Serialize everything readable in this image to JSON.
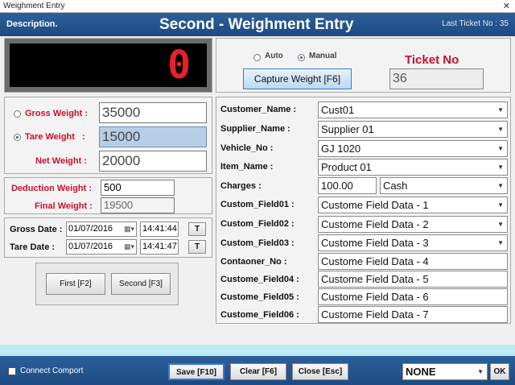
{
  "window": {
    "title": "Weighment Entry",
    "close_glyph": "✕"
  },
  "header": {
    "description": "Description.",
    "title": "Second - Weighment Entry",
    "last_ticket": "Last Ticket No :  35"
  },
  "display": {
    "digit": "0",
    "digit_color": "#e8202a"
  },
  "mode": {
    "auto_label": "Auto",
    "manual_label": "Manual",
    "selected": "Manual",
    "capture_label": "Capture Weight [F6]"
  },
  "ticket": {
    "label": "Ticket No",
    "value": "36"
  },
  "weights": {
    "gross_label": "Gross Weight :",
    "gross_value": "35000",
    "tare_label": "Tare Weight   :",
    "tare_value": "15000",
    "net_label": "Net Weight :",
    "net_value": "20000",
    "selected": "Tare"
  },
  "deduction": {
    "label": "Deduction Weight :",
    "value": "500",
    "final_label": "Final Weight :",
    "final_value": "19500"
  },
  "dates": {
    "gross_label": "Gross Date :",
    "gross_date": "01/07/2016",
    "gross_time": "14:41:44",
    "tare_label": "Tare Date :",
    "tare_date": "01/07/2016",
    "tare_time": "14:41:47",
    "t_label": "T"
  },
  "entry_buttons": {
    "first": "First [F2]",
    "second": "Second [F3]"
  },
  "form": {
    "customer_label": "Customer_Name :",
    "customer_value": "Cust01",
    "supplier_label": "Supplier_Name :",
    "supplier_value": "Supplier 01",
    "vehicle_label": "Vehicle_No :",
    "vehicle_value": "GJ 1020",
    "item_label": "Item_Name :",
    "item_value": "Product 01",
    "charges_label": "Charges :",
    "charges_value": "100.00",
    "payment_value": "Cash",
    "cf01_label": "Custom_Field01 :",
    "cf01_value": "Custome Field Data - 1",
    "cf02_label": "Custom_Field02 :",
    "cf02_value": "Custome Field Data - 2",
    "cf03_label": "Custom_Field03 :",
    "cf03_value": "Custome Field Data - 3",
    "container_label": "Contaoner_No :",
    "container_value": "Custome Field Data - 4",
    "cf04_label": "Custome_Field04 :",
    "cf04_value": "Custome Field Data - 5",
    "cf05_label": "Custome_Field05 :",
    "cf05_value": "Custome Field Data - 6",
    "cf06_label": "Custome_Field06 :",
    "cf06_value": "Custome Field Data - 7"
  },
  "footer": {
    "connect_label": "Connect Comport",
    "save": "Save [F10]",
    "clear": "Clear [F6]",
    "close": "Close [Esc]",
    "port_value": "NONE",
    "ok": "OK"
  }
}
